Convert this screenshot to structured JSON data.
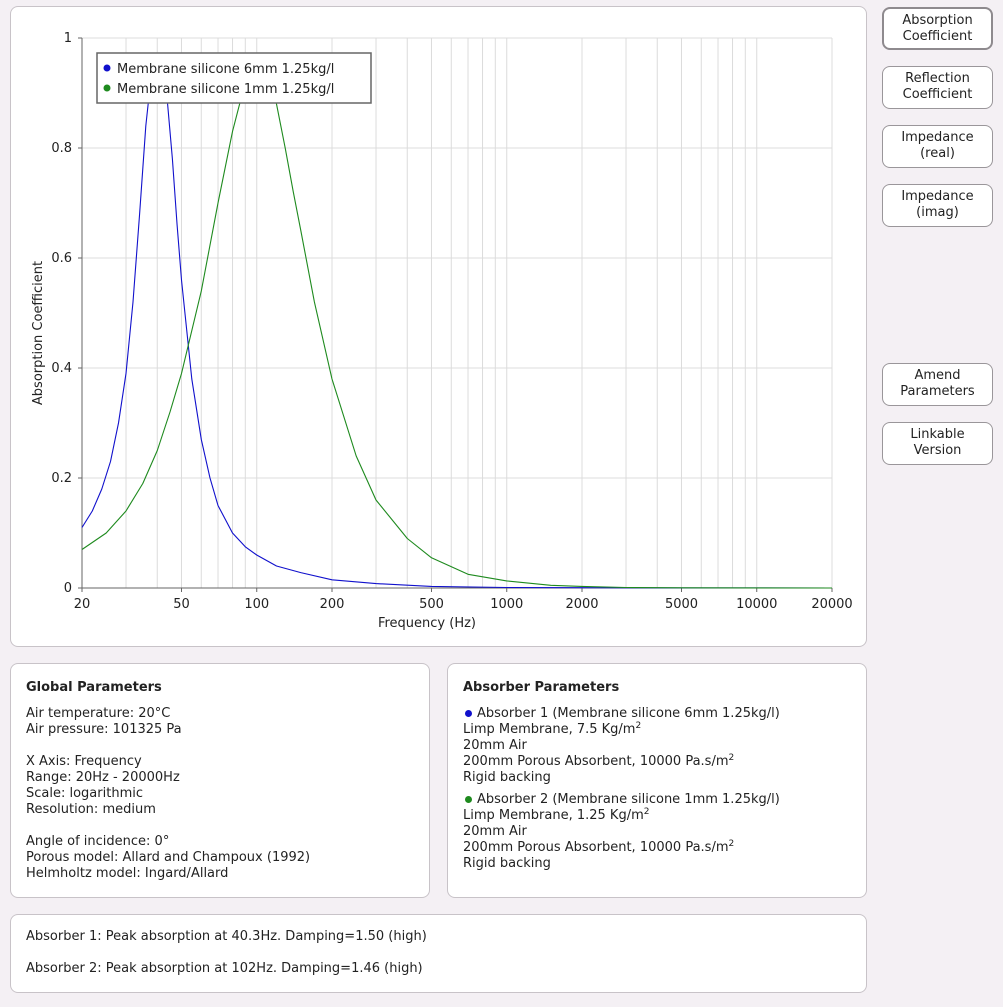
{
  "chart_data": {
    "type": "line",
    "xlabel": "Frequency (Hz)",
    "ylabel": "Absorption Coefficient",
    "xscale": "log",
    "xlim": [
      20,
      20000
    ],
    "ylim": [
      0,
      1
    ],
    "x_ticks": [
      20,
      50,
      100,
      200,
      500,
      1000,
      2000,
      5000,
      10000,
      20000
    ],
    "x_tick_labels": [
      "20",
      "50",
      "100",
      "200",
      "500",
      "1000",
      "2000",
      "5000",
      "10000",
      "20000"
    ],
    "y_ticks": [
      0,
      0.2,
      0.4,
      0.6,
      0.8,
      1
    ],
    "y_tick_labels": [
      "0",
      "0.2",
      "0.4",
      "0.6",
      "0.8",
      "1"
    ],
    "grid": true,
    "legend_position": "top-left",
    "series": [
      {
        "name": "Membrane silicone 6mm 1.25kg/l",
        "color": "#1010cc",
        "x": [
          20,
          22,
          24,
          26,
          28,
          30,
          32,
          34,
          36,
          38,
          40,
          42,
          44,
          46,
          48,
          50,
          55,
          60,
          65,
          70,
          80,
          90,
          100,
          120,
          150,
          200,
          300,
          500,
          1000,
          2000,
          5000,
          20000
        ],
        "y": [
          0.11,
          0.14,
          0.18,
          0.23,
          0.3,
          0.39,
          0.52,
          0.68,
          0.84,
          0.94,
          0.97,
          0.95,
          0.88,
          0.78,
          0.66,
          0.56,
          0.38,
          0.27,
          0.2,
          0.15,
          0.1,
          0.075,
          0.06,
          0.04,
          0.028,
          0.015,
          0.008,
          0.003,
          0.001,
          0.0005,
          0.0001,
          0
        ]
      },
      {
        "name": "Membrane silicone 1mm 1.25kg/l",
        "color": "#1e8a1e",
        "x": [
          20,
          25,
          30,
          35,
          40,
          45,
          50,
          60,
          70,
          80,
          90,
          100,
          110,
          120,
          130,
          140,
          150,
          170,
          200,
          250,
          300,
          400,
          500,
          700,
          1000,
          1500,
          2000,
          3000,
          5000,
          10000,
          20000
        ],
        "y": [
          0.07,
          0.1,
          0.14,
          0.19,
          0.25,
          0.32,
          0.39,
          0.54,
          0.7,
          0.83,
          0.92,
          0.96,
          0.94,
          0.88,
          0.8,
          0.72,
          0.65,
          0.52,
          0.38,
          0.24,
          0.16,
          0.09,
          0.055,
          0.025,
          0.013,
          0.005,
          0.003,
          0.001,
          0.0004,
          0.0001,
          0
        ]
      }
    ]
  },
  "buttons": {
    "absorption_l1": "Absorption",
    "absorption_l2": "Coefficient",
    "reflection_l1": "Reflection",
    "reflection_l2": "Coefficient",
    "imp_real_l1": "Impedance",
    "imp_real_l2": "(real)",
    "imp_imag_l1": "Impedance",
    "imp_imag_l2": "(imag)",
    "amend_l1": "Amend",
    "amend_l2": "Parameters",
    "linkable_l1": "Linkable",
    "linkable_l2": "Version"
  },
  "global": {
    "title": "Global Parameters",
    "air_temp": "Air temperature: 20°C",
    "air_pressure": "Air pressure: 101325 Pa",
    "x_axis": "X Axis: Frequency",
    "range": "Range: 20Hz - 20000Hz",
    "scale": "Scale: logarithmic",
    "resolution": "Resolution: medium",
    "angle": "Angle of incidence: 0°",
    "porous_model": "Porous model: Allard and Champoux (1992)",
    "helmholtz_model": "Helmholtz model: Ingard/Allard"
  },
  "absorbers": {
    "title": "Absorber Parameters",
    "a1_heading": "Absorber 1 (Membrane silicone 6mm 1.25kg/l)",
    "a1_layer1": "Limp Membrane, 7.5 Kg/m",
    "a1_layer2": "20mm Air",
    "a1_layer3": "200mm Porous Absorbent, 10000 Pa.s/m",
    "a1_layer4": "Rigid backing",
    "a2_heading": "Absorber 2 (Membrane silicone 1mm 1.25kg/l)",
    "a2_layer1": "Limp Membrane, 1.25 Kg/m",
    "a2_layer2": "20mm Air",
    "a2_layer3": "200mm Porous Absorbent, 10000 Pa.s/m",
    "a2_layer4": "Rigid backing",
    "sup_2": "2",
    "a1_color": "#1010cc",
    "a2_color": "#1e8a1e"
  },
  "summary": {
    "line1": "Absorber 1: Peak absorption at 40.3Hz. Damping=1.50 (high)",
    "line2": "Absorber 2: Peak absorption at 102Hz. Damping=1.46 (high)"
  }
}
